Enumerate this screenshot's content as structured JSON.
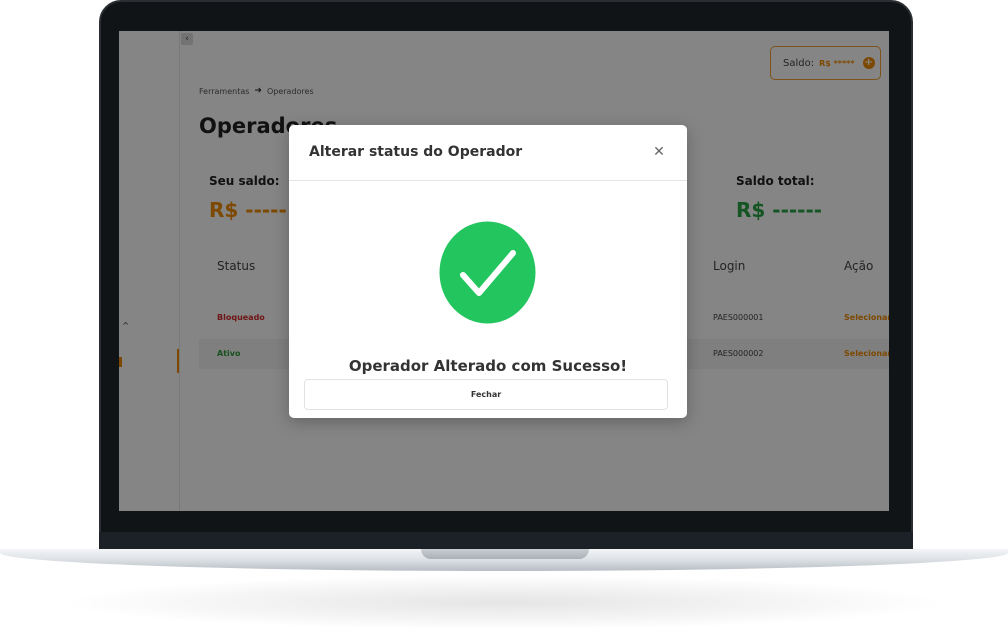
{
  "app": {
    "breadcrumb": [
      "Ferramentas",
      "Operadores"
    ],
    "page_title": "Operadores",
    "balance": {
      "label": "Saldo:",
      "value": "R$ *****"
    },
    "cards": [
      {
        "label": "Seu saldo:",
        "value": "R$ -----",
        "color": "#f08c00"
      },
      {
        "label": "Saldo total:",
        "value": "R$ ------",
        "color": "#27a344"
      }
    ],
    "table": {
      "headers": [
        "Status",
        "Login",
        "Ação"
      ],
      "rows": [
        {
          "status": "Bloqueado",
          "status_color": "#d62b2b",
          "login": "PAES000001",
          "action": "Selecionar"
        },
        {
          "status": "Ativo",
          "status_color": "#2e9b3a",
          "login": "PAES000002",
          "action": "Selecionar"
        }
      ]
    }
  },
  "modal": {
    "title": "Alterar status do Operador",
    "message": "Operador Alterado com Sucesso!",
    "close_label": "Fechar",
    "success_color": "#22c55e",
    "icons": {
      "close": "close-icon",
      "success": "check-circle-icon"
    }
  },
  "colors": {
    "accent": "#f08c00"
  }
}
